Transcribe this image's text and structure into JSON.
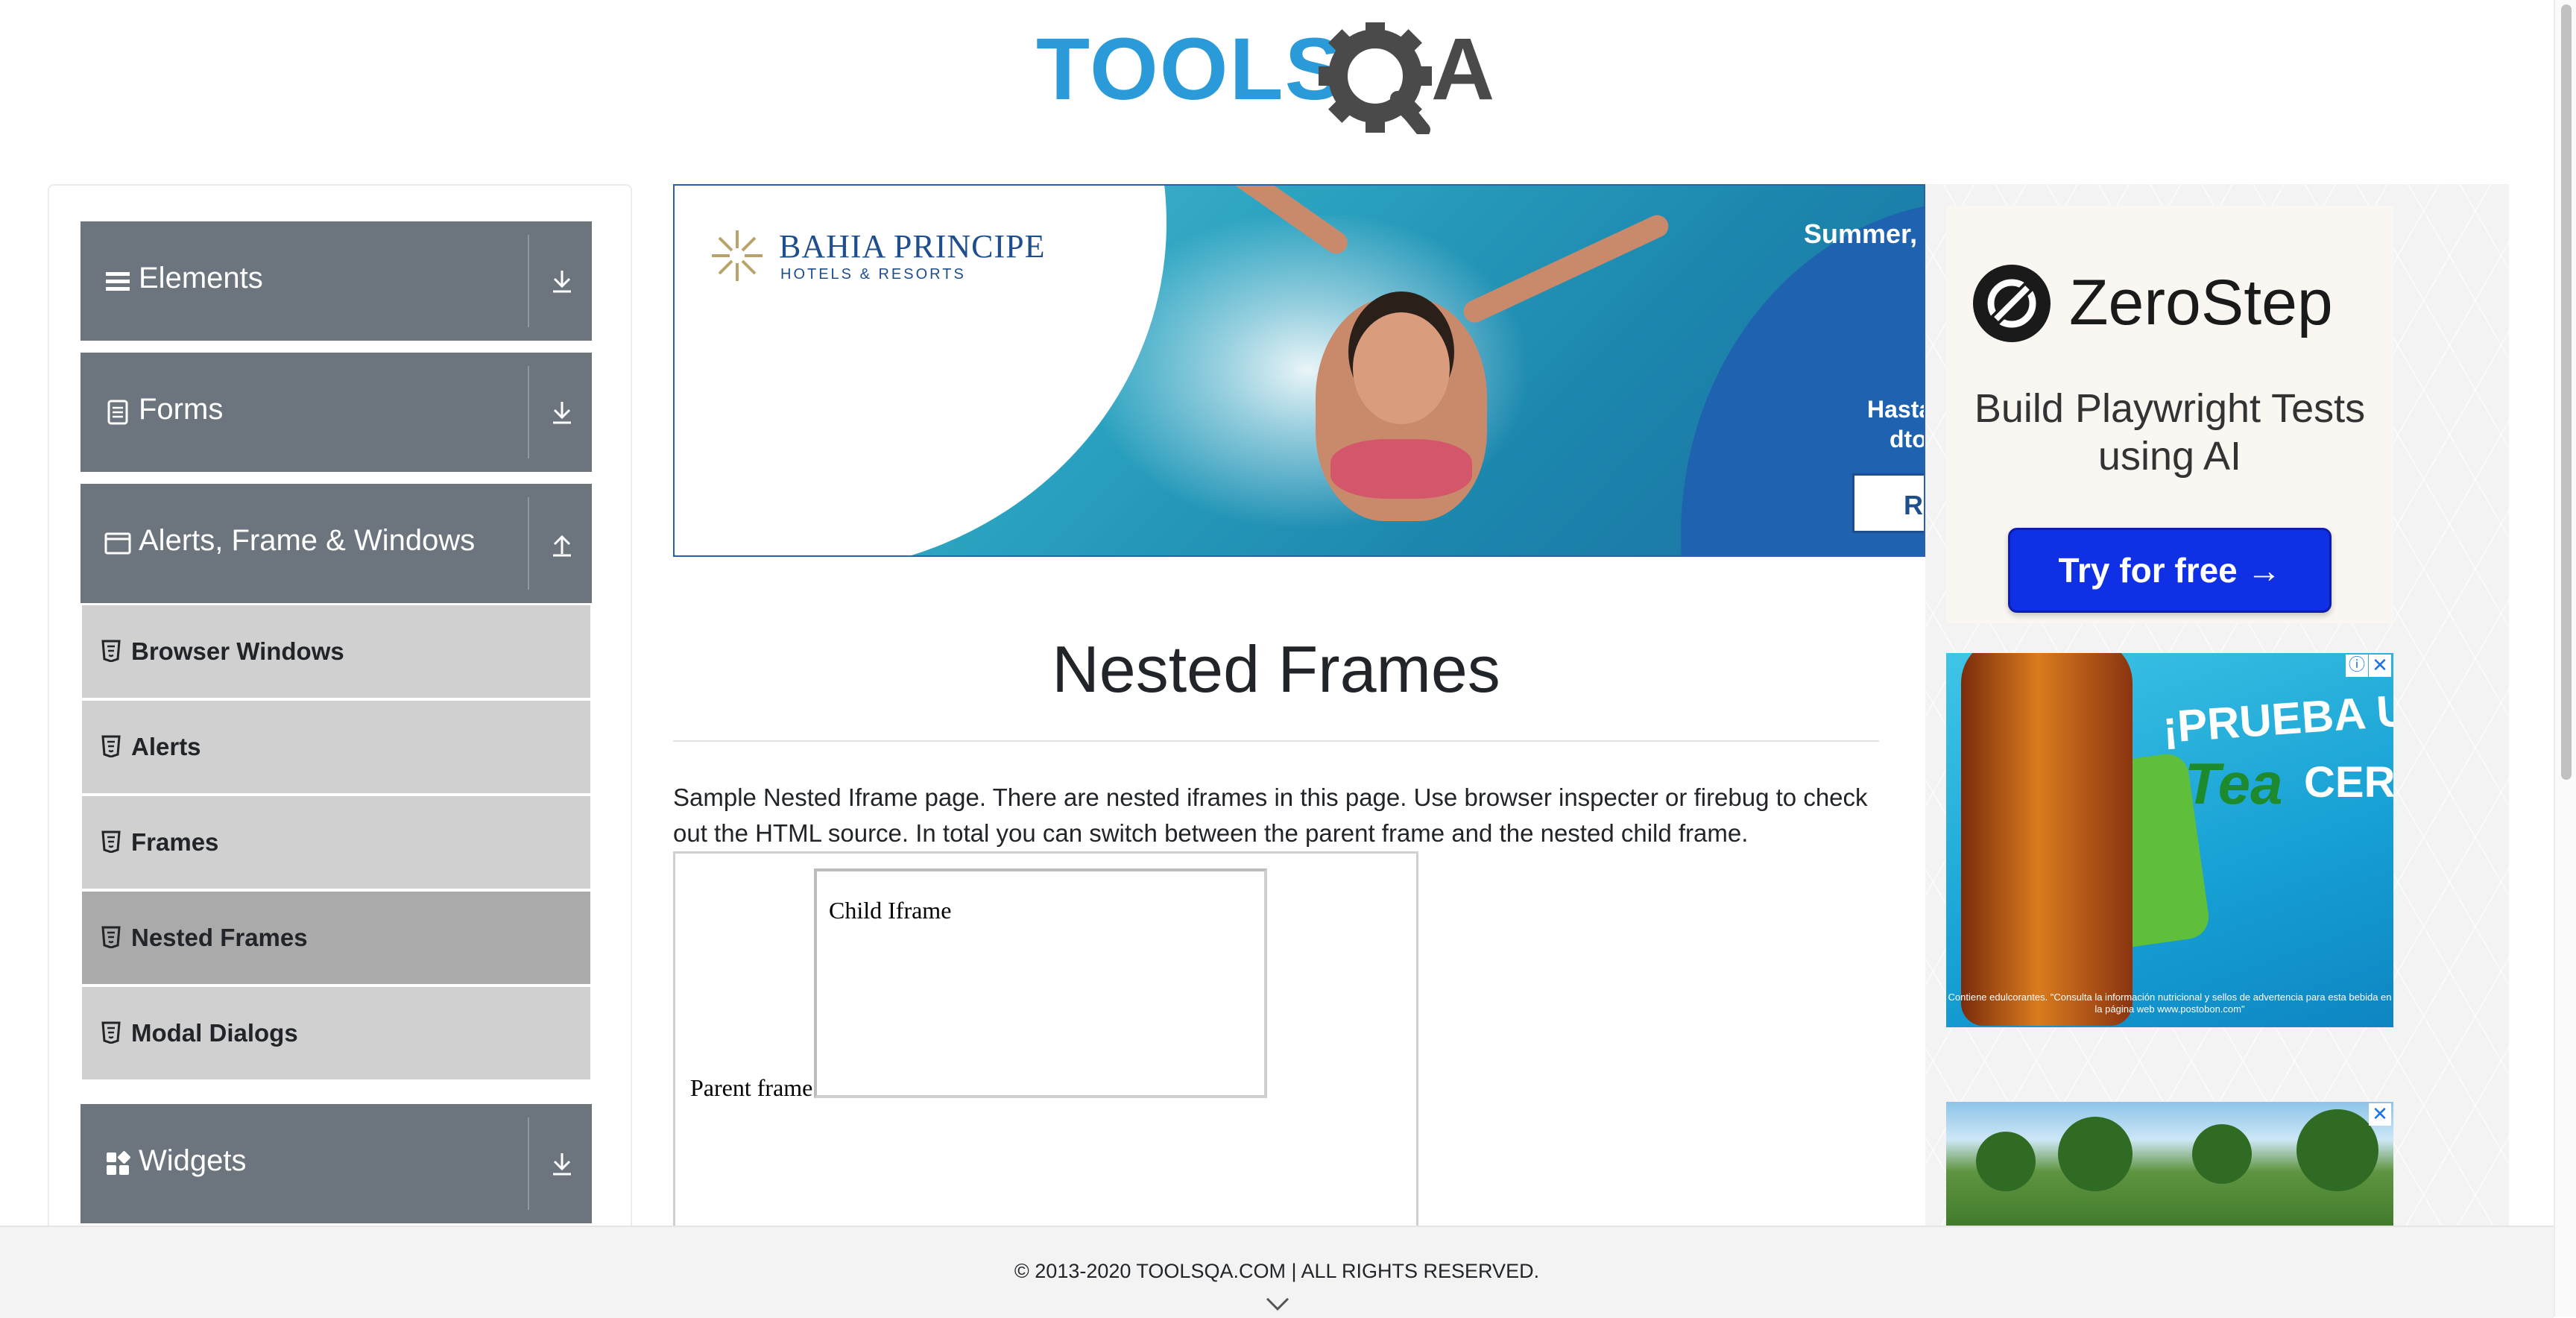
{
  "logo": {
    "text_tools": "TOOLS",
    "text_q": "Q",
    "text_a": "A",
    "colors": {
      "tools": "#2a9bd8",
      "qa": "#4a4a4a"
    }
  },
  "sidebar": {
    "groups": [
      {
        "label": "Elements",
        "icon": "hamburger-icon",
        "state": "collapsed"
      },
      {
        "label": "Forms",
        "icon": "document-icon",
        "state": "collapsed"
      },
      {
        "label": "Alerts, Frame & Windows",
        "icon": "window-icon",
        "state": "expanded"
      },
      {
        "label": "Widgets",
        "icon": "widgets-icon",
        "state": "collapsed"
      }
    ],
    "items": [
      {
        "label": "Browser Windows",
        "active": false
      },
      {
        "label": "Alerts",
        "active": false
      },
      {
        "label": "Frames",
        "active": false
      },
      {
        "label": "Nested Frames",
        "active": true
      },
      {
        "label": "Modal Dialogs",
        "active": false
      }
    ],
    "colors": {
      "header_bg": "#6c757d",
      "item_bg": "#d0d0d0",
      "active_bg": "#aaaaaa"
    }
  },
  "banner_ad": {
    "brand_name": "BAHIA PRINCIPE",
    "brand_sub": "HOTELS & RESORTS",
    "headline": "Summer,",
    "sub_line_1": "Hasta",
    "sub_line_2": "dto",
    "cta": "R"
  },
  "right_ads": {
    "zerostep": {
      "name": "ZeroStep",
      "tagline": "Build Playwright Tests using AI",
      "cta": "Try for free →",
      "cta_color": "#1030e6"
    },
    "drink": {
      "headline": "¡PRUEBA UN",
      "brand": "Tea",
      "cero": "CERO",
      "fine_print": "Contiene edulcorantes. \"Consulta la información nutricional y sellos de advertencia para esta bebida en la página web www.postobon.com\""
    },
    "close_glyph": "✕",
    "info_glyph": "ⓘ"
  },
  "main": {
    "title": "Nested Frames",
    "description": "Sample Nested Iframe page. There are nested iframes in this page. Use browser inspecter or firebug to check out the HTML source. In total you can switch between the parent frame and the nested child frame.",
    "parent_frame_text": "Parent frame",
    "child_frame_text": "Child Iframe"
  },
  "footer": {
    "text": "© 2013-2020 TOOLSQA.COM | ALL RIGHTS RESERVED."
  }
}
